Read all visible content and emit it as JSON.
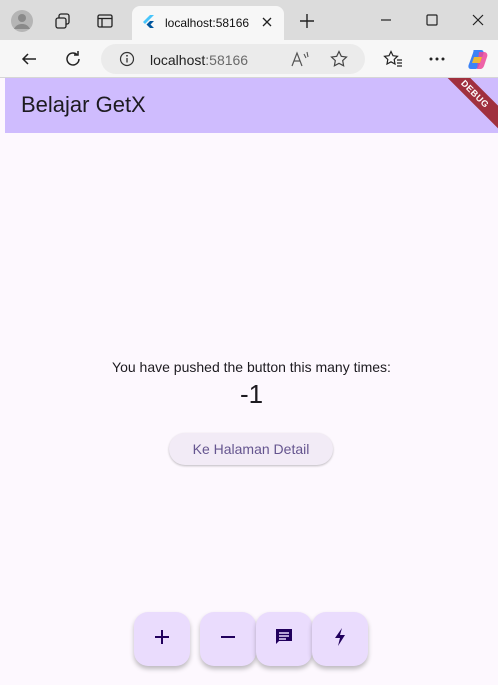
{
  "browser": {
    "tab_title": "localhost:58166",
    "url_host": "localhost",
    "url_port": ":58166",
    "icons": [
      "profile-icon",
      "workspaces-icon",
      "tab-actions-icon",
      "flutter-favicon",
      "close-tab-icon",
      "new-tab-icon",
      "minimize-icon",
      "maximize-icon",
      "close-window-icon",
      "back-icon",
      "refresh-icon",
      "site-info-icon",
      "read-aloud-icon",
      "favorite-star-icon",
      "favorites-icon",
      "more-icon",
      "copilot-icon"
    ]
  },
  "app": {
    "title": "Belajar GetX",
    "debug_banner": "DEBUG",
    "message": "You have pushed the button this many times:",
    "counter": "-1",
    "detail_button": "Ke Halaman Detail",
    "fabs": [
      "add-icon",
      "remove-icon",
      "message-icon",
      "bolt-icon"
    ]
  },
  "colors": {
    "appbar": "#cfbcfe",
    "background": "#fdf8fe",
    "fab": "#eadcfd",
    "button_text": "#65558f",
    "debug_banner": "#a0303e"
  }
}
